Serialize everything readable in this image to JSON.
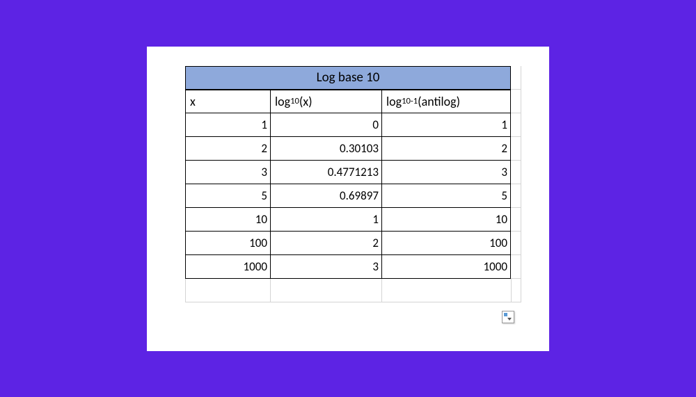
{
  "chart_data": {
    "type": "table",
    "title": "Log base 10",
    "columns": [
      "x",
      "log10(x)",
      "log10^-1 (antilog)"
    ],
    "rows": [
      [
        1,
        0,
        1
      ],
      [
        2,
        0.30103,
        2
      ],
      [
        3,
        0.4771213,
        3
      ],
      [
        5,
        0.69897,
        5
      ],
      [
        10,
        1,
        10
      ],
      [
        100,
        2,
        100
      ],
      [
        1000,
        3,
        1000
      ]
    ]
  },
  "table": {
    "title": "Log base 10",
    "headers": {
      "x": "x",
      "log_prefix": "log",
      "log_base": "10",
      "log_suffix": "(x)",
      "antilog_prefix": "log",
      "antilog_base": "10",
      "antilog_exp": "-1",
      "antilog_suffix": " (antilog)"
    },
    "rows": [
      {
        "x": "1",
        "log": "0",
        "antilog": "1"
      },
      {
        "x": "2",
        "log": "0.30103",
        "antilog": "2"
      },
      {
        "x": "3",
        "log": "0.4771213",
        "antilog": "3"
      },
      {
        "x": "5",
        "log": "0.69897",
        "antilog": "5"
      },
      {
        "x": "10",
        "log": "1",
        "antilog": "10"
      },
      {
        "x": "100",
        "log": "2",
        "antilog": "100"
      },
      {
        "x": "1000",
        "log": "3",
        "antilog": "1000"
      }
    ]
  }
}
